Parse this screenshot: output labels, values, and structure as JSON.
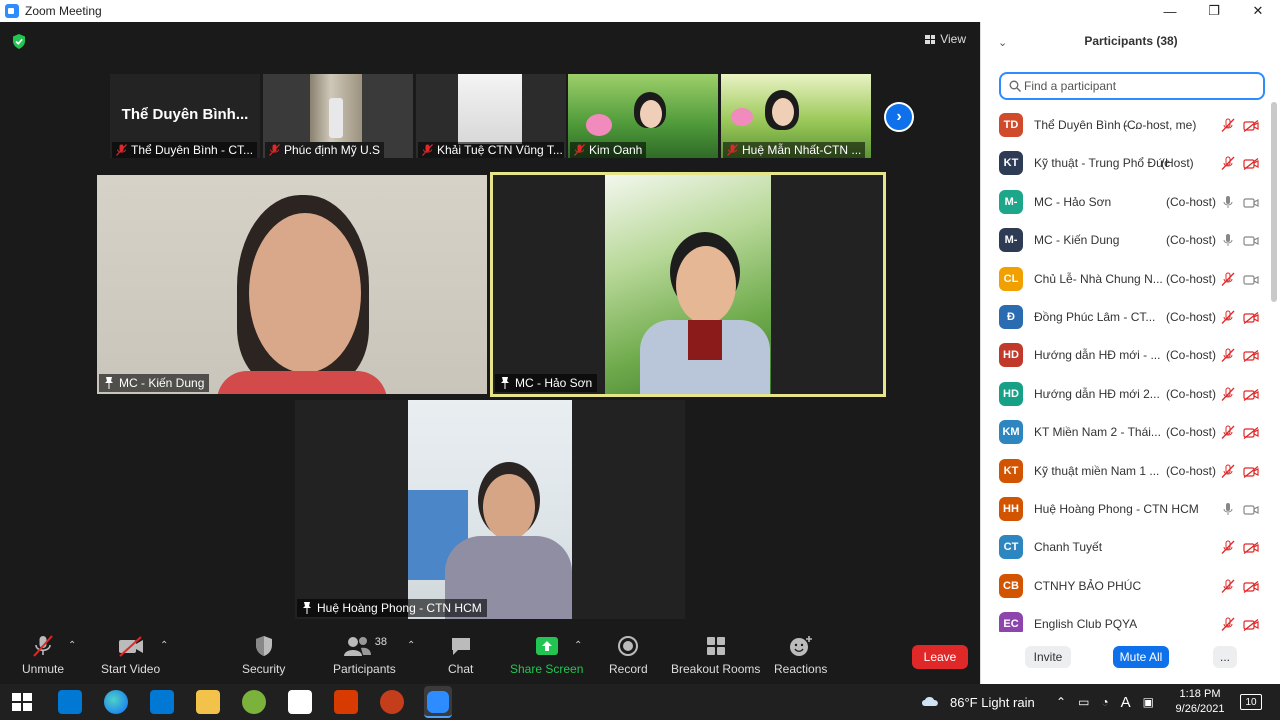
{
  "window": {
    "title": "Zoom Meeting",
    "minimize": "—",
    "restore": "❐",
    "close": "✕"
  },
  "meeting": {
    "view_label": "View",
    "gallery": [
      {
        "name": "Thể Duyên Bình - CT...",
        "big_name": "Thể Duyên Bình..."
      },
      {
        "name": "Phúc định Mỹ U.S"
      },
      {
        "name": "Khải Tuệ CTN Vũng T..."
      },
      {
        "name": "Kim Oanh"
      },
      {
        "name": "Huệ Mẫn Nhất-CTN ..."
      }
    ],
    "tiles": [
      {
        "name": "MC - Kiến Dung"
      },
      {
        "name": "MC - Hảo Sơn"
      },
      {
        "name": "Huệ Hoàng Phong - CTN HCM"
      }
    ]
  },
  "toolbar": {
    "unmute": "Unmute",
    "start_video": "Start Video",
    "security": "Security",
    "participants": "Participants",
    "participants_count": "38",
    "chat": "Chat",
    "share_screen": "Share Screen",
    "record": "Record",
    "breakout_rooms": "Breakout Rooms",
    "reactions": "Reactions",
    "leave": "Leave"
  },
  "panel": {
    "title": "Participants (38)",
    "search_placeholder": "Find a participant",
    "participants": [
      {
        "initials": "TD",
        "color": "#d04a2c",
        "name": "Thể Duyên Bình - ...",
        "role": "(Co-host, me)",
        "mic": "off",
        "cam": "off"
      },
      {
        "initials": "KT",
        "color": "#2e3b55",
        "name": "Kỹ thuật - Trung Phổ Đức",
        "role": "(Host)",
        "mic": "off",
        "cam": "off"
      },
      {
        "initials": "M-",
        "color": "#1ea68a",
        "name": "MC - Hảo Sơn",
        "role": "(Co-host)",
        "mic": "on",
        "cam": "on"
      },
      {
        "initials": "M-",
        "color": "#2e3b55",
        "name": "MC - Kiến Dung",
        "role": "(Co-host)",
        "mic": "on",
        "cam": "on"
      },
      {
        "initials": "CL",
        "color": "#f2a000",
        "name": "Chủ Lễ- Nhà Chung N...",
        "role": "(Co-host)",
        "mic": "off",
        "cam": "on"
      },
      {
        "initials": "Đ",
        "color": "#2b6cb0",
        "name": "Đồng Phúc Lâm - CT...",
        "role": "(Co-host)",
        "mic": "off",
        "cam": "off"
      },
      {
        "initials": "HD",
        "color": "#c0392b",
        "name": "Hướng dẫn HĐ mới - ...",
        "role": "(Co-host)",
        "mic": "off",
        "cam": "off"
      },
      {
        "initials": "HD",
        "color": "#16a085",
        "name": "Hướng dẫn HĐ mới 2...",
        "role": "(Co-host)",
        "mic": "off",
        "cam": "off"
      },
      {
        "initials": "KM",
        "color": "#2e86c1",
        "name": "KT Miền Nam 2 - Thái...",
        "role": "(Co-host)",
        "mic": "off",
        "cam": "off"
      },
      {
        "initials": "KT",
        "color": "#d35400",
        "name": "Kỹ thuật miền Nam 1 ...",
        "role": "(Co-host)",
        "mic": "off",
        "cam": "off"
      },
      {
        "initials": "HH",
        "color": "#d35400",
        "name": "Huệ Hoàng Phong - CTN HCM",
        "role": "",
        "mic": "on",
        "cam": "on"
      },
      {
        "initials": "CT",
        "color": "#2e86c1",
        "name": "Chanh Tuyết",
        "role": "",
        "mic": "off",
        "cam": "off"
      },
      {
        "initials": "CB",
        "color": "#d35400",
        "name": "CTNHY BẢO PHÚC",
        "role": "",
        "mic": "off",
        "cam": "off"
      },
      {
        "initials": "EC",
        "color": "#8e44ad",
        "name": "English Club PQYA",
        "role": "",
        "mic": "off",
        "cam": "off"
      }
    ],
    "invite": "Invite",
    "mute_all": "Mute All",
    "more": "..."
  },
  "taskbar": {
    "weather": "86°F  Light rain",
    "time": "1:18 PM",
    "date": "9/26/2021",
    "notifications": "10"
  },
  "colors": {
    "accent": "#2d8cff",
    "active_speaker": "#e6e58a",
    "leave": "#e02828",
    "share": "#23c552",
    "mute_red": "#e02828"
  }
}
